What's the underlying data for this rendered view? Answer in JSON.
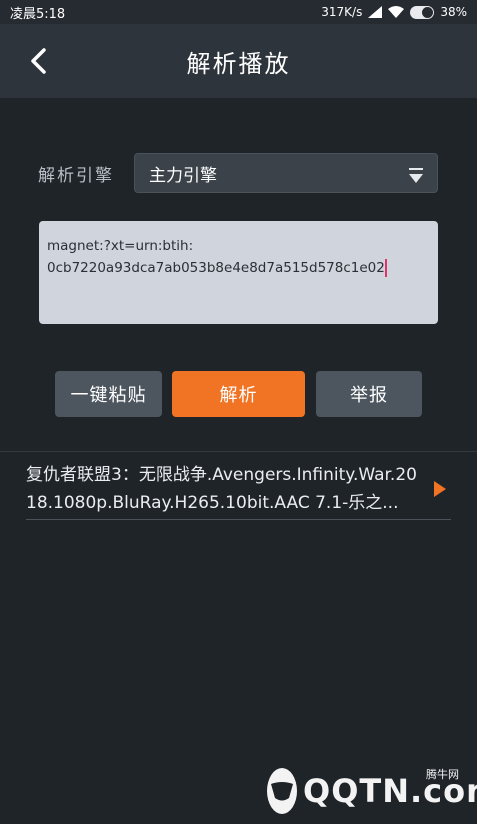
{
  "status_bar": {
    "time": "凌晨5:18",
    "speed": "317K/s",
    "battery": "38%"
  },
  "header": {
    "back_icon": "chevron-left-icon",
    "title": "解析播放"
  },
  "engine": {
    "label": "解析引擎",
    "selected": "主力引擎",
    "dropdown_icon": "dropdown-triangle-icon"
  },
  "link_input": {
    "value": "magnet:?xt=urn:btih:\n0cb7220a93dca7ab053b8e4e8d7a515d578c1e02"
  },
  "buttons": {
    "paste": "一键粘贴",
    "parse": "解析",
    "report": "举报"
  },
  "results": [
    {
      "title": "复仇者联盟3：无限战争.Avengers.Infinity.War.2018.1080p.BluRay.H265.10bit.AAC 7.1-乐之...",
      "icon": "play-triangle-icon"
    }
  ],
  "watermark": {
    "small": "腾牛网",
    "brand": "QQTN.com"
  },
  "colors": {
    "accent": "#f07424",
    "background": "#1f2429",
    "header": "#2e343b",
    "input_bg": "#cfd4dd"
  }
}
